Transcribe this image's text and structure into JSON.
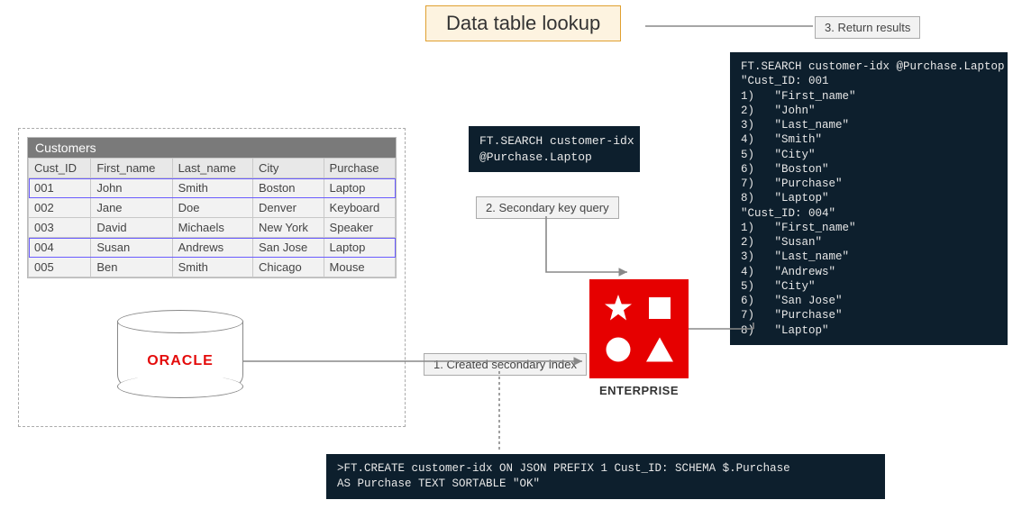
{
  "title": "Data table lookup",
  "table": {
    "name": "Customers",
    "columns": [
      "Cust_ID",
      "First_name",
      "Last_name",
      "City",
      "Purchase"
    ],
    "rows": [
      [
        "001",
        "John",
        "Smith",
        "Boston",
        "Laptop"
      ],
      [
        "002",
        "Jane",
        "Doe",
        "Denver",
        "Keyboard"
      ],
      [
        "003",
        "David",
        "Michaels",
        "New York",
        "Speaker"
      ],
      [
        "004",
        "Susan",
        "Andrews",
        "San Jose",
        "Laptop"
      ],
      [
        "005",
        "Ben",
        "Smith",
        "Chicago",
        "Mouse"
      ]
    ],
    "highlighted_rows": [
      0,
      3
    ]
  },
  "db_source_label": "ORACLE",
  "target_label": "ENTERPRISE",
  "steps": {
    "s1": "1. Created secondary index",
    "s2": "2. Secondary key query",
    "s3": "3. Return results"
  },
  "code": {
    "search_query": "FT.SEARCH customer-idx\n@Purchase.Laptop",
    "create_idx": ">FT.CREATE customer-idx ON JSON PREFIX 1 Cust_ID: SCHEMA $.Purchase\nAS Purchase TEXT SORTABLE \"OK\"",
    "results": "FT.SEARCH customer-idx @Purchase.Laptop\n\"Cust_ID: 001\n1)   \"First_name\"\n2)   \"John\"\n3)   \"Last_name\"\n4)   \"Smith\"\n5)   \"City\"\n6)   \"Boston\"\n7)   \"Purchase\"\n8)   \"Laptop\"\n\"Cust_ID: 004\"\n1)   \"First_name\"\n2)   \"Susan\"\n3)   \"Last_name\"\n4)   \"Andrews\"\n5)   \"City\"\n6)   \"San Jose\"\n7)   \"Purchase\"\n8)   \"Laptop\""
  }
}
